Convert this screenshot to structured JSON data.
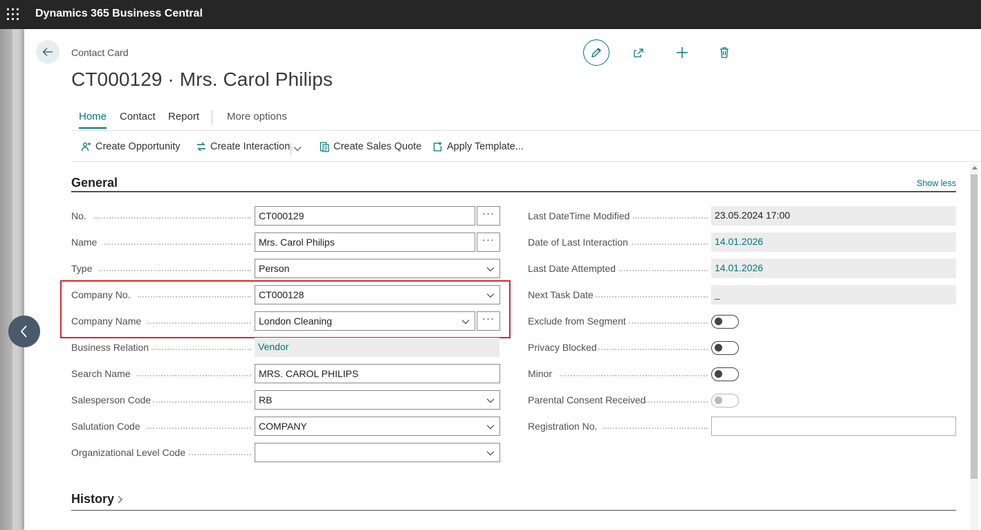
{
  "app": {
    "title": "Dynamics 365 Business Central"
  },
  "page": {
    "caption": "Contact Card",
    "record_title": "CT000129 · Mrs. Carol Philips"
  },
  "header_actions": {
    "edit_icon": "pencil-icon",
    "share_icon": "share-icon",
    "new_icon": "plus-icon",
    "delete_icon": "trash-icon"
  },
  "tabs": [
    {
      "label": "Home",
      "active": true
    },
    {
      "label": "Contact"
    },
    {
      "label": "Report"
    },
    {
      "label": "More options"
    }
  ],
  "actions": [
    {
      "label": "Create Opportunity",
      "icon": "opportunity-icon"
    },
    {
      "label": "Create Interaction",
      "icon": "interaction-icon"
    },
    {
      "label": "Create Sales Quote",
      "icon": "sales-quote-icon"
    },
    {
      "label": "Apply Template...",
      "icon": "apply-template-icon"
    }
  ],
  "general": {
    "title": "General",
    "show_less": "Show less",
    "left_fields": [
      {
        "label": "No.",
        "value": "CT000129"
      },
      {
        "label": "Name",
        "value": "Mrs. Carol Philips"
      },
      {
        "label": "Type",
        "value": "Person"
      },
      {
        "label": "Company No.",
        "value": "CT000128"
      },
      {
        "label": "Company Name",
        "value": "London Cleaning"
      },
      {
        "label": "Business Relation",
        "value": "Vendor"
      },
      {
        "label": "Search Name",
        "value": "MRS. CAROL PHILIPS"
      },
      {
        "label": "Salesperson Code",
        "value": "RB"
      },
      {
        "label": "Salutation Code",
        "value": "COMPANY"
      },
      {
        "label": "Organizational Level Code",
        "value": ""
      }
    ],
    "right_fields": [
      {
        "label": "Last DateTime Modified",
        "value": "23.05.2024 17:00"
      },
      {
        "label": "Date of Last Interaction",
        "value": "14.01.2026"
      },
      {
        "label": "Last Date Attempted",
        "value": "14.01.2026"
      },
      {
        "label": "Next Task Date",
        "value": "_"
      },
      {
        "label": "Exclude from Segment",
        "value": "off"
      },
      {
        "label": "Privacy Blocked",
        "value": "off"
      },
      {
        "label": "Minor",
        "value": "off"
      },
      {
        "label": "Parental Consent Received",
        "value": "off"
      },
      {
        "label": "Registration No.",
        "value": ""
      }
    ]
  },
  "history": {
    "title": "History"
  },
  "colors": {
    "accent": "#00777a",
    "highlight": "#d9262b",
    "topbar": "#262626"
  }
}
